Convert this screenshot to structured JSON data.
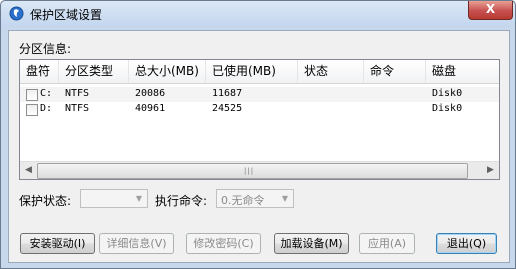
{
  "window": {
    "title": "保护区域设置",
    "close_label": "X"
  },
  "partition_section": {
    "label": "分区信息:"
  },
  "table": {
    "columns": [
      "盘符",
      "分区类型",
      "总大小(MB)",
      "已使用(MB)",
      "状态",
      "命令",
      "磁盘"
    ],
    "rows": [
      {
        "drive": "C:",
        "type": "NTFS",
        "total": "20086",
        "used": "11687",
        "status": "",
        "command": "",
        "disk": "Disk0",
        "checked": false
      },
      {
        "drive": "D:",
        "type": "NTFS",
        "total": "40961",
        "used": "24525",
        "status": "",
        "command": "",
        "disk": "Disk0",
        "checked": false
      }
    ]
  },
  "protect_state": {
    "label": "保护状态:",
    "value": ""
  },
  "exec_command": {
    "label": "执行命令:",
    "value": "0.无命令"
  },
  "buttons": {
    "install": "安装驱动(I)",
    "details": "详细信息(V)",
    "password": "修改密码(C)",
    "load": "加载设备(M)",
    "apply": "应用(A)",
    "exit": "退出(Q)"
  },
  "colors": {
    "titlebar": "#c3d6ee",
    "close": "#c75050",
    "dialog_bg": "#f0f0f0"
  }
}
